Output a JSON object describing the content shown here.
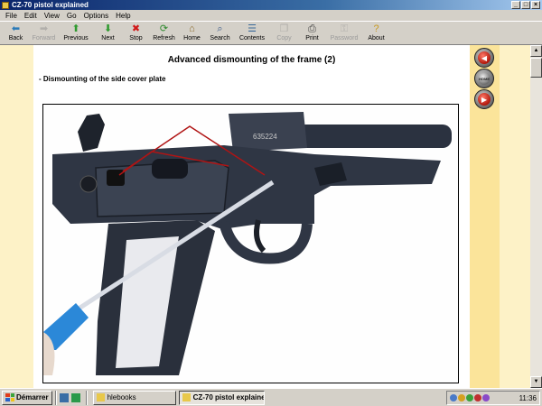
{
  "window": {
    "title": "CZ-70 pistol explained"
  },
  "menu": [
    "File",
    "Edit",
    "View",
    "Go",
    "Options",
    "Help"
  ],
  "toolbar": [
    {
      "name": "back-button",
      "label": "Back",
      "icon": "back-arrow-icon",
      "glyph": "⬅",
      "color": "#2a7ab8",
      "enabled": true
    },
    {
      "name": "forward-button",
      "label": "Forward",
      "icon": "forward-arrow-icon",
      "glyph": "➡",
      "color": "#808080",
      "enabled": false
    },
    {
      "name": "previous-button",
      "label": "Previous",
      "icon": "up-arrow-icon",
      "glyph": "⬆",
      "color": "#2e9a2e",
      "enabled": true
    },
    {
      "name": "next-button",
      "label": "Next",
      "icon": "down-arrow-icon",
      "glyph": "⬇",
      "color": "#2e9a2e",
      "enabled": true
    },
    {
      "name": "stop-button",
      "label": "Stop",
      "icon": "stop-icon",
      "glyph": "✖",
      "color": "#d01818",
      "enabled": true
    },
    {
      "name": "refresh-button",
      "label": "Refresh",
      "icon": "refresh-icon",
      "glyph": "⟳",
      "color": "#2e8a2e",
      "enabled": true
    },
    {
      "name": "home-button",
      "label": "Home",
      "icon": "home-icon",
      "glyph": "⌂",
      "color": "#8a6a2a",
      "enabled": true
    },
    {
      "name": "search-button",
      "label": "Search",
      "icon": "search-icon",
      "glyph": "⌕",
      "color": "#3a5a8a",
      "enabled": true
    },
    {
      "name": "contents-button",
      "label": "Contents",
      "icon": "contents-icon",
      "glyph": "☰",
      "color": "#3a6a9a",
      "enabled": true
    },
    {
      "name": "copy-button",
      "label": "Copy",
      "icon": "copy-icon",
      "glyph": "❐",
      "color": "#808080",
      "enabled": false
    },
    {
      "name": "print-button",
      "label": "Print",
      "icon": "printer-icon",
      "glyph": "⎙",
      "color": "#404040",
      "enabled": true
    },
    {
      "name": "password-button",
      "label": "Password",
      "icon": "key-icon",
      "glyph": "⚿",
      "color": "#808080",
      "enabled": false
    },
    {
      "name": "about-button",
      "label": "About",
      "icon": "question-icon",
      "glyph": "?",
      "color": "#c89a20",
      "enabled": true
    }
  ],
  "page": {
    "title": "Advanced dismounting of the frame (2)",
    "subtitle": "- Dismounting of the side cover plate",
    "photo": {
      "serial": "635224"
    }
  },
  "sidebar": {
    "home_label": "HOME"
  },
  "taskbar": {
    "start_label": "Démarrer",
    "items": [
      {
        "label": "hlebooks",
        "active": false
      },
      {
        "label": "CZ-70 pistol explained",
        "active": true
      }
    ],
    "clock": "11:36"
  },
  "colors": {
    "content_bg": "#fdf2c7",
    "sidebar_bg": "#fbe49a",
    "titlebar": "#0a246a"
  }
}
